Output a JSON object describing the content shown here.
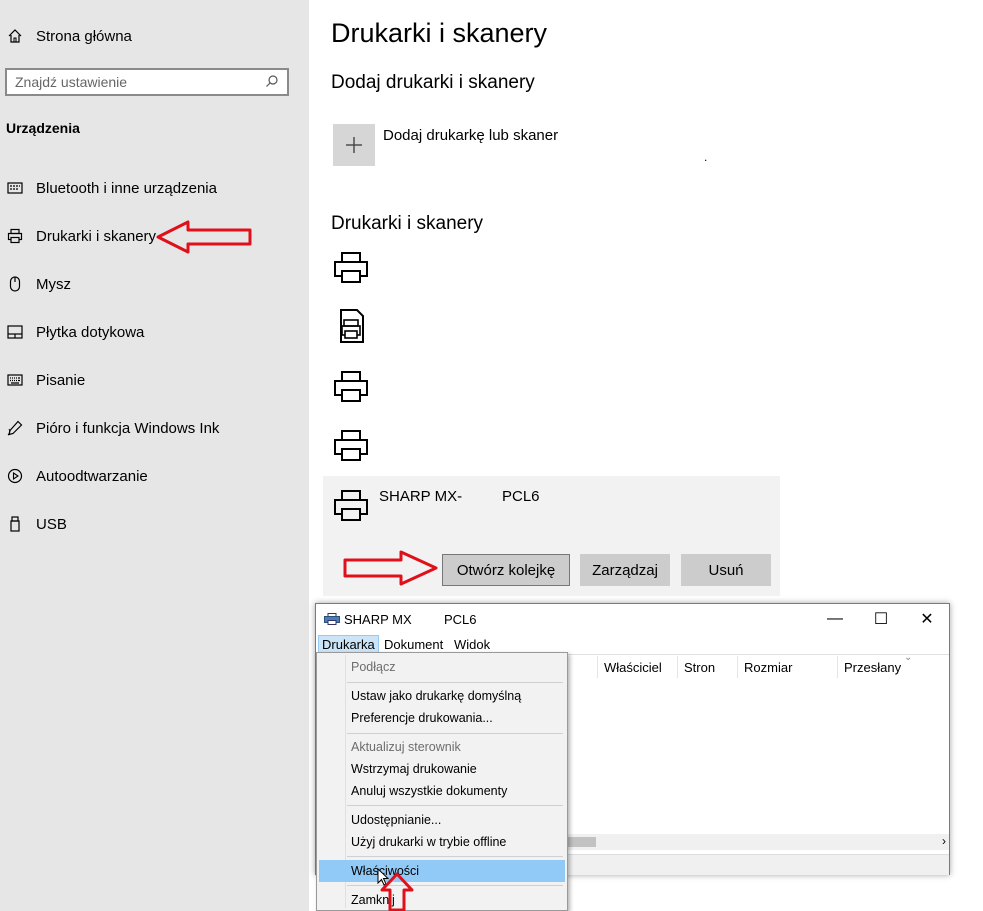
{
  "sidebar": {
    "home_label": "Strona główna",
    "search_placeholder": "Znajdź ustawienie",
    "section_title": "Urządzenia",
    "items": [
      {
        "label": "Bluetooth i inne urządzenia",
        "icon": "bluetooth-devices-icon"
      },
      {
        "label": "Drukarki i skanery",
        "icon": "printer-icon"
      },
      {
        "label": "Mysz",
        "icon": "mouse-icon"
      },
      {
        "label": "Płytka dotykowa",
        "icon": "touchpad-icon"
      },
      {
        "label": "Pisanie",
        "icon": "keyboard-icon"
      },
      {
        "label": "Pióro i funkcja Windows Ink",
        "icon": "pen-icon"
      },
      {
        "label": "Autoodtwarzanie",
        "icon": "autoplay-icon"
      },
      {
        "label": "USB",
        "icon": "usb-icon"
      }
    ]
  },
  "main": {
    "title": "Drukarki i skanery",
    "add_section_title": "Dodaj drukarki i skanery",
    "add_button_label": "Dodaj drukarkę lub skaner",
    "add_dot": ".",
    "printers_section_title": "Drukarki i skanery",
    "selected_printer": {
      "name": "SHARP MX-",
      "driver": "PCL6",
      "buttons": {
        "open_queue": "Otwórz kolejkę",
        "manage": "Zarządzaj",
        "remove": "Usuń"
      }
    }
  },
  "queue_window": {
    "title_name": "SHARP MX",
    "title_driver": "PCL6",
    "controls": {
      "minimize": "—",
      "maximize": "☐",
      "close": "✕"
    },
    "menu": [
      "Drukarka",
      "Dokument",
      "Widok"
    ],
    "columns": [
      "Właściciel",
      "Stron",
      "Rozmiar",
      "Przesłany"
    ],
    "scroll_right": "›"
  },
  "printer_menu": {
    "items": [
      {
        "label": "Podłącz",
        "disabled": true
      },
      {
        "label": "Ustaw jako drukarkę domyślną",
        "disabled": false
      },
      {
        "label": "Preferencje drukowania...",
        "disabled": false
      },
      {
        "label": "Aktualizuj sterownik",
        "disabled": true
      },
      {
        "label": "Wstrzymaj drukowanie",
        "disabled": false
      },
      {
        "label": "Anuluj wszystkie dokumenty",
        "disabled": false
      },
      {
        "label": "Udostępnianie...",
        "disabled": false
      },
      {
        "label": "Użyj drukarki w trybie offline",
        "disabled": false
      },
      {
        "label": "Właściwości",
        "disabled": false,
        "highlighted": true
      },
      {
        "label": "Zamknij",
        "disabled": false
      }
    ]
  },
  "colors": {
    "annotation_arrow": "#e0101a",
    "highlight": "#91c9f7",
    "sidebar_bg": "#e6e6e6"
  }
}
